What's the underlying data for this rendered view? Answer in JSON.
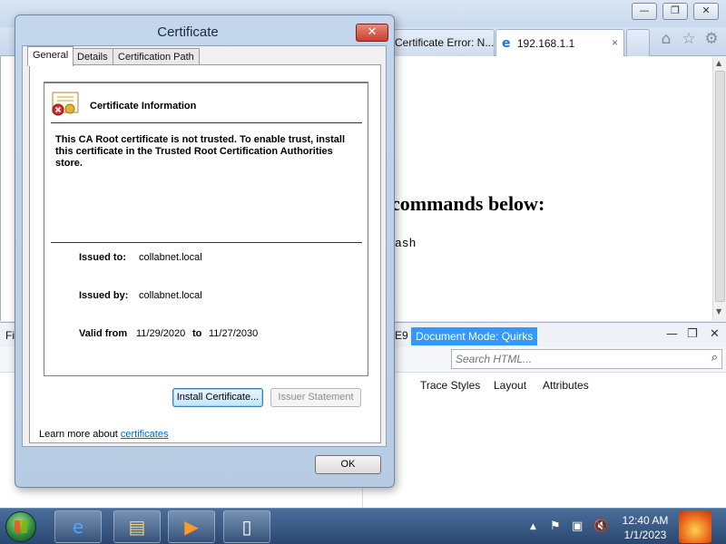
{
  "browser": {
    "tabs": [
      {
        "title": "Certificate Error: N...",
        "active": false
      },
      {
        "title": "192.168.1.1",
        "active": true
      }
    ],
    "tab_close": "×",
    "window_controls": {
      "minimize": "—",
      "restore": "❐",
      "close": "✕"
    },
    "page": {
      "heading": "commands below:",
      "code_fragment": "ash"
    }
  },
  "devtools": {
    "menu_left": "Fi",
    "mode_fragment": "E9",
    "document_mode": "Document Mode: Quirks",
    "search_placeholder": "Search HTML...",
    "tabs": [
      "Trace Styles",
      "Layout",
      "Attributes"
    ]
  },
  "dialog": {
    "title": "Certificate",
    "close_label": "✕",
    "tabs": [
      "General",
      "Details",
      "Certification Path"
    ],
    "info_title": "Certificate Information",
    "warning": "This CA Root certificate is not trusted. To enable trust, install this certificate in the Trusted Root Certification Authorities store.",
    "issued_to_label": "Issued to:",
    "issued_to": "collabnet.local",
    "issued_by_label": "Issued by:",
    "issued_by": "collabnet.local",
    "valid_from_label": "Valid from",
    "valid_from": "11/29/2020",
    "to_label": "to",
    "valid_to": "11/27/2030",
    "install_button": "Install Certificate...",
    "issuer_button": "Issuer Statement",
    "learn_more_prefix": "Learn more about",
    "learn_more_link": "certificates",
    "ok_button": "OK"
  },
  "taskbar": {
    "time": "12:40 AM",
    "date": "1/1/2023"
  },
  "colors": {
    "selection_blue": "#3399ff",
    "link_blue": "#0066cc",
    "close_red": "#c7402c"
  }
}
